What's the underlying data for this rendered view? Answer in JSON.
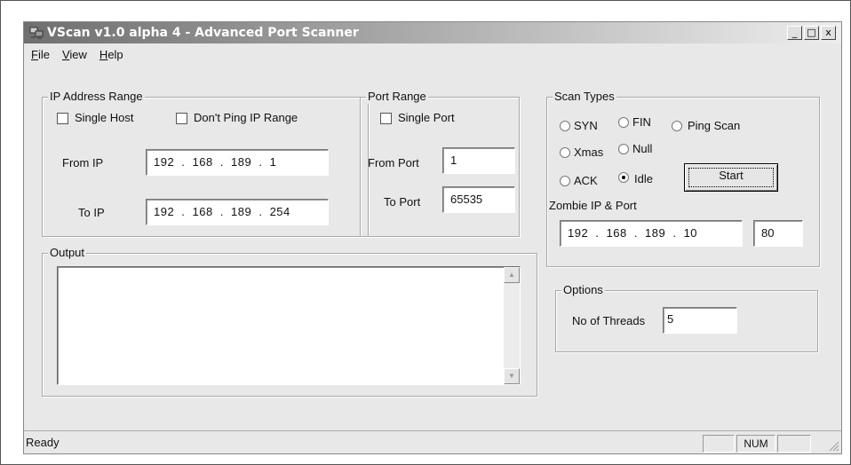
{
  "window": {
    "title": "VScan v1.0 alpha 4 - Advanced Port Scanner",
    "icon": "computer-network-icon",
    "controls": {
      "minimize": "_",
      "maximize": "□",
      "close": "x"
    }
  },
  "menu": [
    "File",
    "View",
    "Help"
  ],
  "ip_range": {
    "legend": "IP Address Range",
    "single_host": "Single Host",
    "dont_ping": "Don't Ping IP Range",
    "from_label": "From IP",
    "from_value": "192 . 168 . 189 . 1",
    "to_label": "To IP",
    "to_value": "192 . 168 . 189 . 254"
  },
  "port_range": {
    "legend": "Port Range",
    "single_port": "Single Port",
    "from_label": "From Port",
    "from_value": "1",
    "to_label": "To Port",
    "to_value": "65535"
  },
  "scan_types": {
    "legend": "Scan Types",
    "options": [
      "SYN",
      "FIN",
      "Ping Scan",
      "Xmas",
      "Null",
      "ACK",
      "Idle"
    ],
    "selected": "Idle",
    "start_button": "Start",
    "zombie_label": "Zombie IP & Port",
    "zombie_ip": "192 . 168 . 189 . 10",
    "zombie_port": "80"
  },
  "output": {
    "legend": "Output",
    "scroll_up": "▲",
    "scroll_down": "▼"
  },
  "options": {
    "legend": "Options",
    "threads_label": "No of Threads",
    "threads_value": "5"
  },
  "status": {
    "text": "Ready",
    "num": "NUM"
  }
}
